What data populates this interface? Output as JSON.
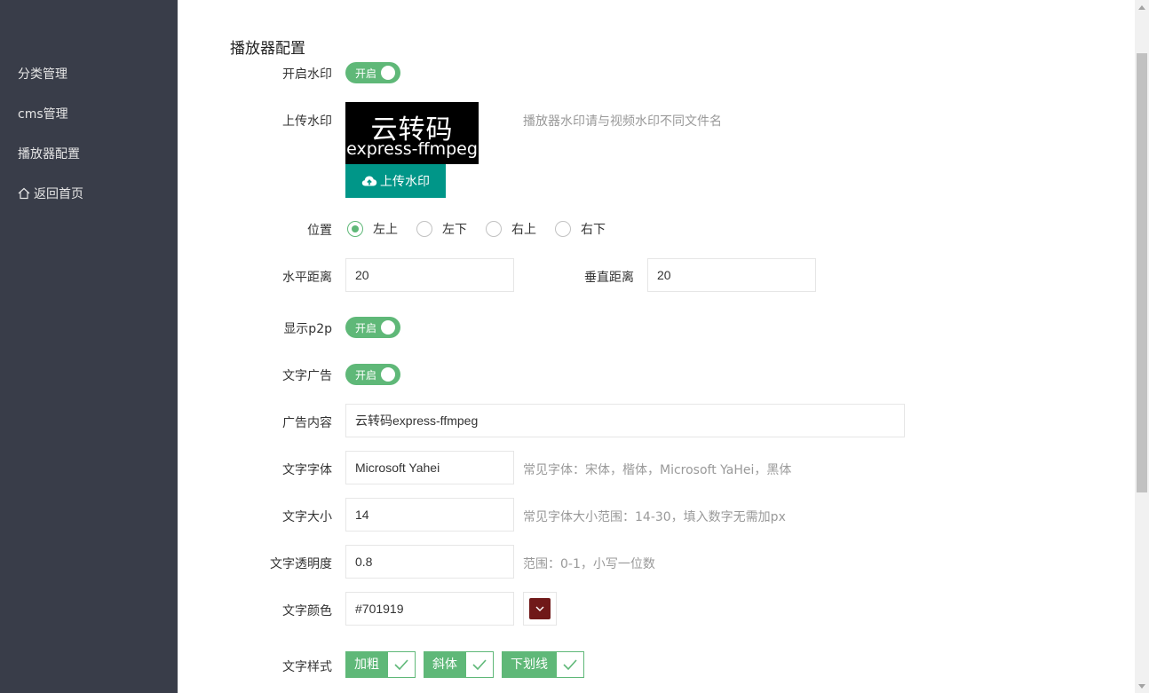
{
  "sidebar": {
    "items": [
      {
        "label": "分类管理"
      },
      {
        "label": "cms管理"
      },
      {
        "label": "播放器配置"
      },
      {
        "label": "返回首页",
        "icon": "home-icon"
      }
    ],
    "background": "#393d49"
  },
  "page": {
    "title": "播放器配置"
  },
  "form": {
    "watermark_toggle": {
      "label": "开启水印",
      "state": "开启",
      "on": true
    },
    "upload": {
      "label": "上传水印",
      "preview_line1": "云转码",
      "preview_line2": "express-ffmpeg",
      "button_label": "上传水印",
      "hint": "播放器水印请与视频水印不同文件名"
    },
    "position": {
      "label": "位置",
      "options": [
        "左上",
        "左下",
        "右上",
        "右下"
      ],
      "selected": "左上"
    },
    "horizontal": {
      "label": "水平距离",
      "value": "20"
    },
    "vertical": {
      "label": "垂直距离",
      "value": "20"
    },
    "p2p_toggle": {
      "label": "显示p2p",
      "state": "开启",
      "on": true
    },
    "text_ad_toggle": {
      "label": "文字广告",
      "state": "开启",
      "on": true
    },
    "ad_content": {
      "label": "广告内容",
      "value": "云转码express-ffmpeg"
    },
    "font": {
      "label": "文字字体",
      "value": "Microsoft Yahei",
      "hint": "常见字体：宋体，楷体，Microsoft YaHei，黑体"
    },
    "font_size": {
      "label": "文字大小",
      "value": "14",
      "hint": "常见字体大小范围：14-30，填入数字无需加px"
    },
    "opacity": {
      "label": "文字透明度",
      "value": "0.8",
      "hint": "范围：0-1，小写一位数"
    },
    "color": {
      "label": "文字颜色",
      "value": "#701919"
    },
    "style": {
      "label": "文字样式",
      "options": [
        "加粗",
        "斜体",
        "下划线"
      ],
      "checked": [
        true,
        true,
        true
      ]
    }
  },
  "colors": {
    "accent": "#5fb878",
    "upload_button": "#009688"
  }
}
